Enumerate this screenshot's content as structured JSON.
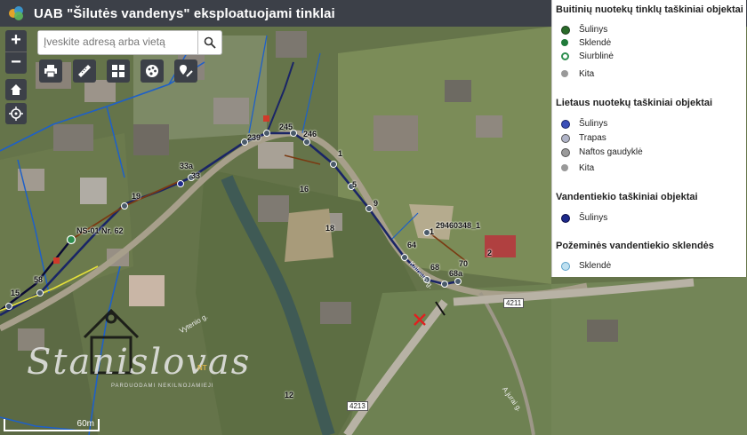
{
  "app": {
    "title": "UAB \"Šilutės vandenys\" eksploatuojami tinklai"
  },
  "search": {
    "placeholder": "Įveskite adresą arba vietą"
  },
  "controls": {
    "zoom_in": "+",
    "zoom_out": "−"
  },
  "legend": {
    "sections": [
      {
        "title": "Buitinių nuotekų tinklų taškiniai objektai",
        "items": [
          {
            "label": "Šulinys",
            "color": "#2a6b2a"
          },
          {
            "label": "Sklendė",
            "color": "#1f7a3a"
          },
          {
            "label": "Siurblinė",
            "color": "#2f8f4f"
          },
          {
            "label": "Kita",
            "color": "#999999"
          }
        ]
      },
      {
        "title": "Lietaus nuotekų taškiniai objektai",
        "items": [
          {
            "label": "Šulinys",
            "color": "#3b4fb8"
          },
          {
            "label": "Trapas",
            "color": "#8a8fa8"
          },
          {
            "label": "Naftos gaudyklė",
            "color": "#7a7a7a"
          },
          {
            "label": "Kita",
            "color": "#999999"
          }
        ]
      },
      {
        "title": "Vandentiekio taškiniai objektai",
        "items": [
          {
            "label": "Šulinys",
            "color": "#1e2a8a"
          }
        ]
      },
      {
        "title": "Požeminės vandentiekio sklendės",
        "items": [
          {
            "label": "Sklendė",
            "color": "#5aa0c8"
          }
        ]
      }
    ]
  },
  "map_labels": [
    "245",
    "246",
    "239",
    "1",
    "5",
    "9",
    "33a",
    "33",
    "19",
    "NS-01 Nr. 62",
    "29460348_1",
    "1",
    "64",
    "68",
    "70",
    "68a",
    "58",
    "15",
    "16",
    "18",
    "2",
    "12"
  ],
  "road_labels": {
    "vytenio": "Vytenio g.",
    "kalnelio": "Kalnelio g.",
    "a": "A.jurai g."
  },
  "road_shields": [
    "4211",
    "4213"
  ],
  "scale": {
    "label": "60m"
  },
  "watermark": {
    "text": "Stanislovas",
    "sub": "PARDUODAMI NEKILNOJAMIEJI",
    "tag": "NT"
  }
}
